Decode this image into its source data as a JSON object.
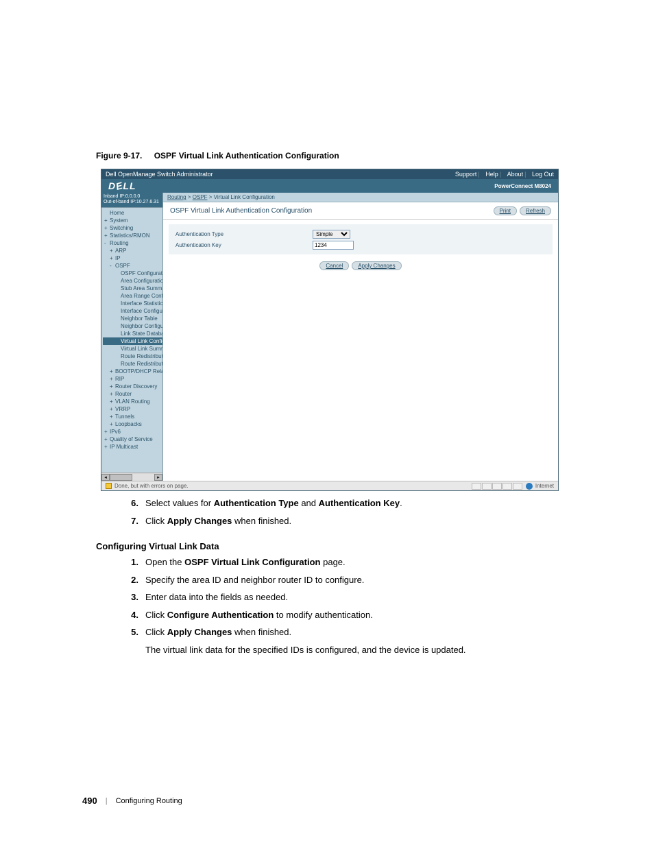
{
  "figure": {
    "number": "Figure 9-17.",
    "title": "OSPF Virtual Link Authentication Configuration"
  },
  "admin": {
    "window_title": "Dell OpenManage Switch Administrator",
    "title_links": [
      "Support",
      "Help",
      "About",
      "Log Out"
    ],
    "brand": "DELL",
    "device_label": "PowerConnect M8024",
    "ip_inband": "Inband IP:0.0.0.0",
    "ip_outband": "Out-of-band IP:10.27.6.31",
    "tree": [
      {
        "label": "Home",
        "indent": 0,
        "exp": ""
      },
      {
        "label": "System",
        "indent": 0,
        "exp": "+"
      },
      {
        "label": "Switching",
        "indent": 0,
        "exp": "+"
      },
      {
        "label": "Statistics/RMON",
        "indent": 0,
        "exp": "+"
      },
      {
        "label": "Routing",
        "indent": 0,
        "exp": "-"
      },
      {
        "label": "ARP",
        "indent": 1,
        "exp": "+"
      },
      {
        "label": "IP",
        "indent": 1,
        "exp": "+"
      },
      {
        "label": "OSPF",
        "indent": 1,
        "exp": "-"
      },
      {
        "label": "OSPF Configuration",
        "indent": 2,
        "exp": ""
      },
      {
        "label": "Area Configuration",
        "indent": 2,
        "exp": ""
      },
      {
        "label": "Stub Area Summary",
        "indent": 2,
        "exp": ""
      },
      {
        "label": "Area Range Configu",
        "indent": 2,
        "exp": ""
      },
      {
        "label": "Interface Statistics",
        "indent": 2,
        "exp": ""
      },
      {
        "label": "Interface Configurati",
        "indent": 2,
        "exp": ""
      },
      {
        "label": "Neighbor Table",
        "indent": 2,
        "exp": ""
      },
      {
        "label": "Neighbor Configurat",
        "indent": 2,
        "exp": ""
      },
      {
        "label": "Link State Database",
        "indent": 2,
        "exp": ""
      },
      {
        "label": "Virtual Link Config",
        "indent": 2,
        "exp": "",
        "sel": true
      },
      {
        "label": "Virtual Link Summa",
        "indent": 2,
        "exp": ""
      },
      {
        "label": "Route Redistribution",
        "indent": 2,
        "exp": ""
      },
      {
        "label": "Route Redistribution",
        "indent": 2,
        "exp": ""
      },
      {
        "label": "BOOTP/DHCP Relay A",
        "indent": 1,
        "exp": "+"
      },
      {
        "label": "RIP",
        "indent": 1,
        "exp": "+"
      },
      {
        "label": "Router Discovery",
        "indent": 1,
        "exp": "+"
      },
      {
        "label": "Router",
        "indent": 1,
        "exp": "+"
      },
      {
        "label": "VLAN Routing",
        "indent": 1,
        "exp": "+"
      },
      {
        "label": "VRRP",
        "indent": 1,
        "exp": "+"
      },
      {
        "label": "Tunnels",
        "indent": 1,
        "exp": "+"
      },
      {
        "label": "Loopbacks",
        "indent": 1,
        "exp": "+"
      },
      {
        "label": "IPv6",
        "indent": 0,
        "exp": "+"
      },
      {
        "label": "Quality of Service",
        "indent": 0,
        "exp": "+"
      },
      {
        "label": "IP Multicast",
        "indent": 0,
        "exp": "+"
      }
    ],
    "breadcrumb": {
      "part1": "Routing",
      "part2": "OSPF",
      "part3": "Virtual Link Configuration",
      "sep": " > "
    },
    "content_title": "OSPF Virtual Link Authentication Configuration",
    "buttons": {
      "print": "Print",
      "refresh": "Refresh",
      "cancel": "Cancel",
      "apply": "Apply Changes"
    },
    "rows": [
      {
        "label": "Authentication Type",
        "control": "select",
        "value": "Simple"
      },
      {
        "label": "Authentication Key",
        "control": "input",
        "value": "1234"
      }
    ],
    "status_left": "Done, but with errors on page.",
    "status_right": "Internet"
  },
  "steps_a": [
    {
      "num": "6.",
      "parts": [
        "Select values for ",
        {
          "b": "Authentication Type"
        },
        " and ",
        {
          "b": "Authentication Key"
        },
        "."
      ]
    },
    {
      "num": "7.",
      "parts": [
        "Click ",
        {
          "b": "Apply Changes"
        },
        " when finished."
      ]
    }
  ],
  "section_heading": "Configuring Virtual Link Data",
  "steps_b": [
    {
      "num": "1.",
      "parts": [
        "Open the ",
        {
          "b": "OSPF Virtual Link Configuration"
        },
        " page."
      ]
    },
    {
      "num": "2.",
      "parts": [
        "Specify the area ID and neighbor router ID to configure."
      ]
    },
    {
      "num": "3.",
      "parts": [
        "Enter data into the fields as needed."
      ]
    },
    {
      "num": "4.",
      "parts": [
        "Click ",
        {
          "b": "Configure Authentication"
        },
        " to modify authentication."
      ]
    },
    {
      "num": "5.",
      "parts": [
        "Click ",
        {
          "b": "Apply Changes"
        },
        " when finished."
      ],
      "after": "The virtual link data for the specified IDs is configured, and the device is updated."
    }
  ],
  "footer": {
    "page_num": "490",
    "section": "Configuring Routing"
  }
}
